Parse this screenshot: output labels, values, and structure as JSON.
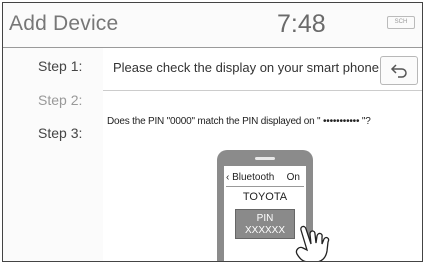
{
  "header": {
    "title": "Add Device",
    "clock": "7:48",
    "status_badge": "SCH"
  },
  "steps": [
    {
      "label": "Step 1:"
    },
    {
      "label": "Step 2:"
    },
    {
      "label": "Step 3:"
    }
  ],
  "main": {
    "instruction": "Please check the display on your smart phone.",
    "question": "Does the PIN \"0000\" match the PIN displayed on \" ••••••••••• \"?",
    "phone": {
      "bluetooth_label": "‹ Bluetooth",
      "bluetooth_state": "On",
      "device_name": "TOYOTA",
      "pin_label": "PIN",
      "pin_value": "XXXXXX"
    }
  },
  "icons": {
    "back": "back-arrow-icon",
    "hand": "hand-touch-icon"
  }
}
